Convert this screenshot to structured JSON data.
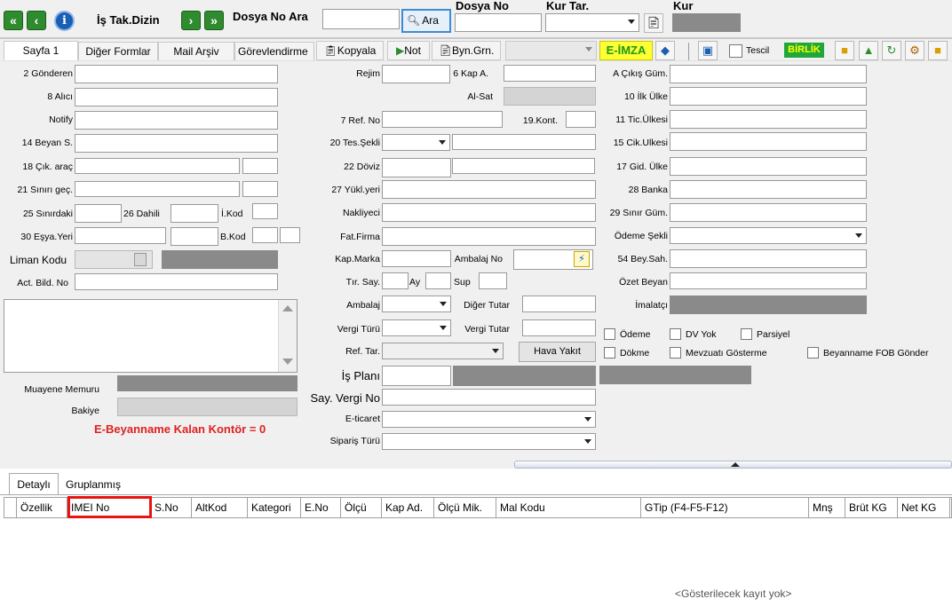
{
  "toolbar": {
    "title": "İş Tak.Dizin",
    "first_label": "«",
    "prev_label": "‹",
    "info_label": "i",
    "next_label": "›",
    "last_label": "»",
    "dosya_no_ara_label": "Dosya No Ara",
    "ara_button": "Ara",
    "dosya_no_label": "Dosya No",
    "kur_tar_label": "Kur Tar.",
    "kur_label": "Kur"
  },
  "tabs": {
    "sayfa1": "Sayfa 1",
    "diger_formlar": "Diğer Formlar",
    "mail_arsiv": "Mail Arşiv",
    "gorevlendirme": "Görevlendirme",
    "kopyala": "Kopyala",
    "not": "Not",
    "byn_grn": "Byn.Grn.",
    "e_imza": "E-İMZA",
    "tescil": "Tescil",
    "birlik": "BİRLİK"
  },
  "left": {
    "gonderen": "2 Gönderen",
    "alici": "8 Alıcı",
    "notify": "Notify",
    "beyan_s": "14 Beyan S.",
    "cik_arac": "18 Çık. araç",
    "sinir_gec": "21 Sınırı geç.",
    "sinirdaki": "25 Sınırdaki",
    "dahili": "26 Dahili",
    "i_kod": "İ.Kod",
    "esya_yeri": "30 Eşya.Yeri",
    "b_kod": "B.Kod",
    "liman_kodu": "Liman Kodu",
    "act_bild_no": "Act. Bild. No",
    "muayene_memuru": "Muayene Memuru",
    "bakiye": "Bakiye",
    "kontor": "E-Beyanname Kalan Kontör = 0"
  },
  "middle": {
    "rejim": "Rejim",
    "kap_a": "6 Kap A.",
    "al_sat": "Al-Sat",
    "ref_no": "7 Ref. No",
    "kont": "19.Kont.",
    "tes_sekli": "20 Tes.Şekli",
    "doviz": "22 Döviz",
    "yukl_yeri": "27 Yükl.yeri",
    "nakliyeci": "Nakliyeci",
    "fat_firma": "Fat.Firma",
    "kap_marka": "Kap.Marka",
    "ambalaj_no": "Ambalaj No",
    "tir_say": "Tır. Say.",
    "ay": "Ay",
    "sup": "Sup",
    "ambalaj": "Ambalaj",
    "diger_tutar": "Diğer Tutar",
    "vergi_turu": "Vergi Türü",
    "vergi_tutar": "Vergi Tutar",
    "ref_tar": "Ref. Tar.",
    "hava_yakit": "Hava Yakıt",
    "is_plani": "İş Planı",
    "say_vergi_no": "Say. Vergi No",
    "e_ticaret": "E-ticaret",
    "siparis_turu": "Sipariş Türü"
  },
  "right": {
    "a_cikis_gum": "A Çıkış Güm.",
    "ilk_ulke": "10 İlk Ülke",
    "tic_ulkesi": "11 Tic.Ülkesi",
    "cik_ulkesi": "15 Cik.Ulkesi",
    "gid_ulke": "17 Gid. Ülke",
    "banka": "28 Banka",
    "sinir_gum": "29 Sınır Güm.",
    "odeme_sekli": "Ödeme Şekli",
    "bey_sah": "54 Bey.Sah.",
    "ozet_beyan": "Özet Beyan",
    "imalatci": "İmalatçı",
    "odeme": "Ödeme",
    "dv_yok": "DV Yok",
    "parsiyel": "Parsiyel",
    "dokme": "Dökme",
    "mevzuati_gosterme": "Mevzuatı Gösterme",
    "beyanname_fob": "Beyanname FOB Gönder"
  },
  "bottom": {
    "tab_detayli": "Detaylı",
    "tab_gruplanmis": "Gruplanmış",
    "columns": [
      "Özellik",
      "IMEI No",
      "S.No",
      "AltKod",
      "Kategori",
      "E.No",
      "Ölçü",
      "Kap Ad.",
      "Ölçü Mik.",
      "Mal Kodu",
      "GTip (F4-F5-F12)",
      "Mnş",
      "Brüt KG",
      "Net KG"
    ],
    "empty_text": "<Gösterilecek kayıt yok>",
    "highlight_color": "#e81414"
  },
  "colors": {
    "nav_green": "#2e8b2e",
    "info_blue": "#1a5fb4",
    "eimza_bg": "#ffff33",
    "birlik_bg": "#1fa73a",
    "kontor_red": "#e02020"
  }
}
